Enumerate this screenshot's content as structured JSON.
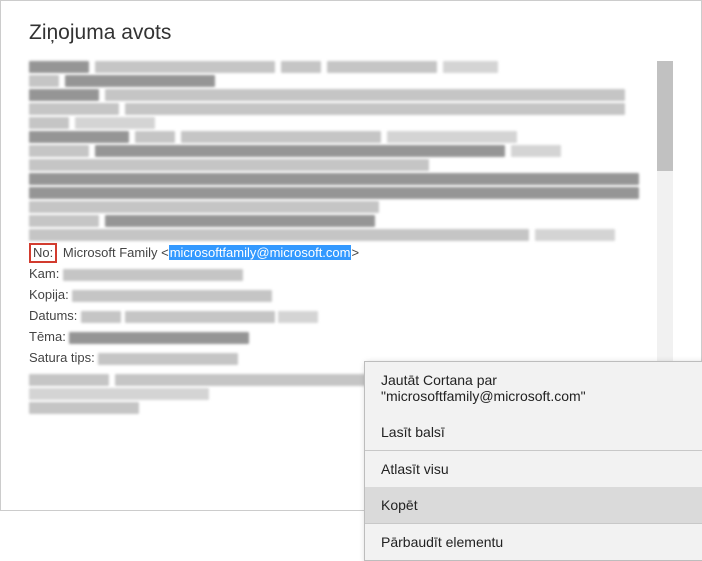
{
  "window": {
    "title": "Ziņojuma avots"
  },
  "headers": {
    "from_label": "No:",
    "from_name": "Microsoft Family",
    "from_email": "microsoftfamily@microsoft.com",
    "to_label": "Kam:",
    "cc_label": "Kopija:",
    "date_label": "Datums:",
    "subject_label": "Tēma:",
    "content_type_label": "Satura tips:"
  },
  "context_menu": {
    "ask_cortana": "Jautāt Cortana par \"microsoftfamily@microsoft.com\"",
    "read_aloud": "Lasīt balsī",
    "select_all": "Atlasīt visu",
    "copy": "Kopēt",
    "inspect": "Pārbaudīt elementu"
  }
}
